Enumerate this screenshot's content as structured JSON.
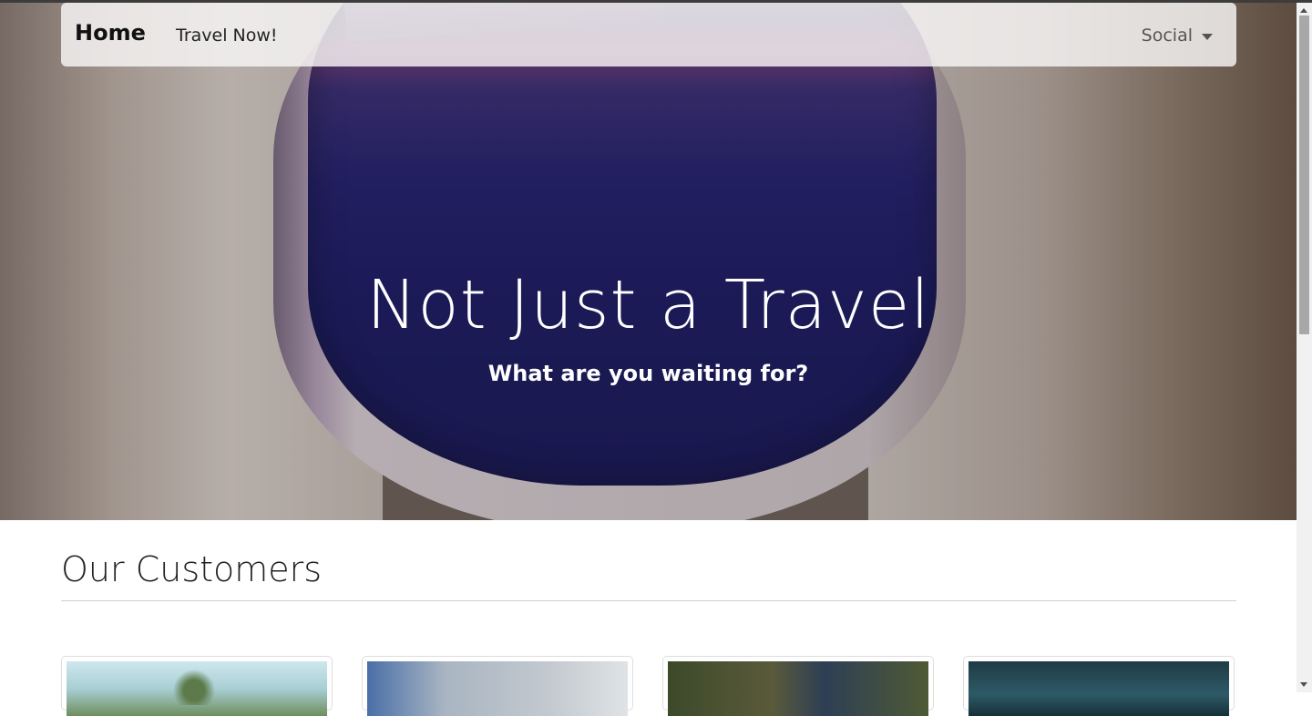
{
  "navbar": {
    "brand": "Home",
    "link": "Travel Now!",
    "social_label": "Social"
  },
  "hero": {
    "title": "Not Just a Travel",
    "subtitle": "What are you waiting for?"
  },
  "customers": {
    "title": "Our Customers",
    "cards": [
      {
        "image": "palm-trees-photo"
      },
      {
        "image": "man-running-photo"
      },
      {
        "image": "person-in-tree-photo"
      },
      {
        "image": "water-photo"
      }
    ]
  },
  "colors": {
    "hero_window": "#1b1b63",
    "navbar_bg": "#f8f6f6",
    "text_dark": "#222222"
  },
  "icons": [
    "dropdown-caret-icon"
  ]
}
